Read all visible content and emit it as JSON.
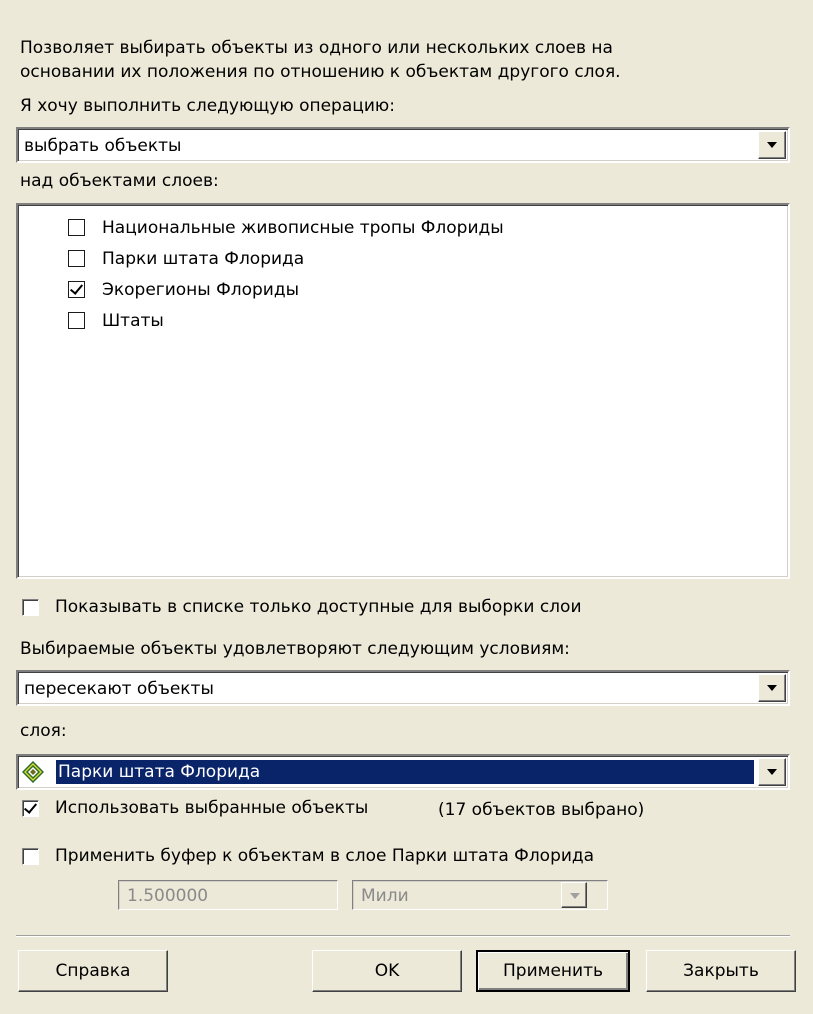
{
  "description_line1": "Позволяет выбирать объекты из одного или нескольких слоев на",
  "description_line2": "основании их положения по отношению к объектам другого слоя.",
  "operation_label": "Я хочу выполнить следующую операцию:",
  "operation_value": "выбрать объекты",
  "target_layers_label": "над объектами слоев:",
  "layers": [
    {
      "label": "Национальные живописные тропы Флориды",
      "checked": false
    },
    {
      "label": "Парки штата Флорида",
      "checked": false
    },
    {
      "label": "Экорегионы Флориды",
      "checked": true
    },
    {
      "label": "Штаты",
      "checked": false
    }
  ],
  "show_selectable_only": {
    "label": "Показывать в списке только доступные для выборки слои",
    "checked": false
  },
  "condition_label": "Выбираемые объекты удовлетворяют следующим условиям:",
  "condition_value": "пересекают объекты",
  "source_layer_label": "слоя:",
  "source_layer_value": "Парки штата Флорида",
  "use_selected": {
    "label": "Использовать выбранные объекты",
    "count_text": "(17 объектов выбрано)",
    "checked": true
  },
  "apply_buffer": {
    "label": "Применить буфер к объектам в слое Парки штата Флорида",
    "checked": false
  },
  "buffer_distance": "1.500000",
  "buffer_units": "Мили",
  "buttons": {
    "help": "Справка",
    "ok": "OK",
    "apply": "Применить",
    "close": "Закрыть"
  },
  "icons": {
    "layer": "polygon-layer-icon",
    "dropdown": "chevron-down-icon"
  },
  "colors": {
    "background": "#ece9d8",
    "selection": "#0a246a"
  }
}
